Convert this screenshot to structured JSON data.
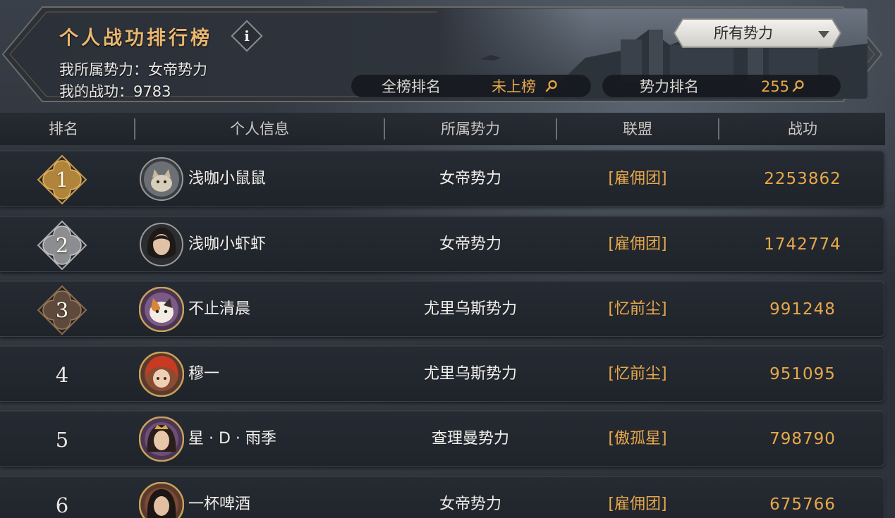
{
  "header": {
    "title": "个人战功排行榜",
    "info_icon": "info-icon",
    "info_glyph": "i",
    "my_faction": "我所属势力：女帝势力",
    "my_merit": "我的战功：9783",
    "faction_filter": {
      "selected": "所有势力",
      "icon": "triangle-down-icon"
    },
    "global_rank": {
      "label": "全榜排名",
      "value": "未上榜",
      "icon": "magnifier-icon"
    },
    "faction_rank": {
      "label": "势力排名",
      "value": "255",
      "icon": "magnifier-icon"
    }
  },
  "columns": [
    "排名",
    "个人信息",
    "所属势力",
    "联盟",
    "战功"
  ],
  "rows": [
    {
      "rank": "1",
      "name": "浅咖小鼠鼠",
      "faction": "女帝势力",
      "alliance": "[雇佣团]",
      "merit": "2253862",
      "badge": "gold",
      "avatar": "cat-avatar"
    },
    {
      "rank": "2",
      "name": "浅咖小虾虾",
      "faction": "女帝势力",
      "alliance": "[雇佣团]",
      "merit": "1742774",
      "badge": "silver",
      "avatar": "woman-avatar"
    },
    {
      "rank": "3",
      "name": "不止清晨",
      "faction": "尤里乌斯势力",
      "alliance": "[忆前尘]",
      "merit": "991248",
      "badge": "bronze",
      "avatar": "calico-cat-avatar"
    },
    {
      "rank": "4",
      "name": "穆一",
      "faction": "尤里乌斯势力",
      "alliance": "[忆前尘]",
      "merit": "951095",
      "badge": "none",
      "avatar": "red-hair-avatar"
    },
    {
      "rank": "5",
      "name": "星 · D · 雨季",
      "faction": "查理曼势力",
      "alliance": "[傲孤星]",
      "merit": "798790",
      "badge": "none",
      "avatar": "crowned-woman-avatar"
    },
    {
      "rank": "6",
      "name": "一杯啤酒",
      "faction": "女帝势力",
      "alliance": "[雇佣团]",
      "merit": "675766",
      "badge": "none",
      "avatar": "dark-hair-avatar"
    }
  ],
  "colors": {
    "title": "#e9b770",
    "accent": "#e7a84a",
    "gold_badge": "#b0843a",
    "silver_badge": "#8c8d90",
    "bronze_badge": "#5d4a3d"
  }
}
